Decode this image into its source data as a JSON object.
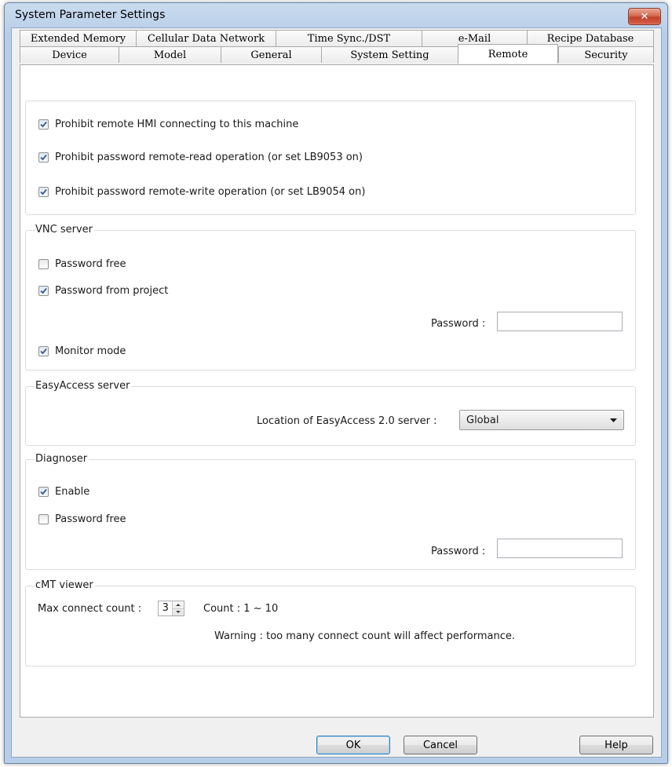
{
  "window": {
    "title": "System Parameter Settings",
    "close_label": "✕"
  },
  "tabs": {
    "row1": [
      "Extended Memory",
      "Cellular Data Network",
      "Time Sync./DST",
      "e-Mail",
      "Recipe Database"
    ],
    "row2": [
      "Device",
      "Model",
      "General",
      "System Setting",
      "Remote",
      "Security"
    ],
    "active": "Remote"
  },
  "remote": {
    "prohibit_hmi": {
      "label": "Prohibit remote HMI connecting to this machine",
      "checked": true
    },
    "prohibit_read": {
      "label": "Prohibit password remote-read operation (or set LB9053 on)",
      "checked": true
    },
    "prohibit_write": {
      "label": "Prohibit password remote-write operation (or set LB9054 on)",
      "checked": true
    }
  },
  "vnc": {
    "title": "VNC server",
    "password_free": {
      "label": "Password free",
      "checked": false
    },
    "password_from_project": {
      "label": "Password from project",
      "checked": true
    },
    "password_label": "Password :",
    "password_value": "",
    "monitor_mode": {
      "label": "Monitor mode",
      "checked": true
    }
  },
  "easyaccess": {
    "title": "EasyAccess server",
    "location_label": "Location of EasyAccess 2.0 server :",
    "location_value": "Global"
  },
  "diagnoser": {
    "title": "Diagnoser",
    "enable": {
      "label": "Enable",
      "checked": true
    },
    "password_free": {
      "label": "Password free",
      "checked": false
    },
    "password_label": "Password :",
    "password_value": ""
  },
  "cmt": {
    "title": "cMT viewer",
    "max_label": "Max connect count :",
    "max_value": "3",
    "range_label": "Count : 1 ~ 10",
    "warning": "Warning : too many connect count will affect performance."
  },
  "buttons": {
    "ok": "OK",
    "cancel": "Cancel",
    "help": "Help"
  },
  "colors": {
    "title_bar": "#bcd1ea",
    "close_button": "#c2412a",
    "panel": "#ffffff",
    "dialog_bg": "#f0f0f0"
  }
}
